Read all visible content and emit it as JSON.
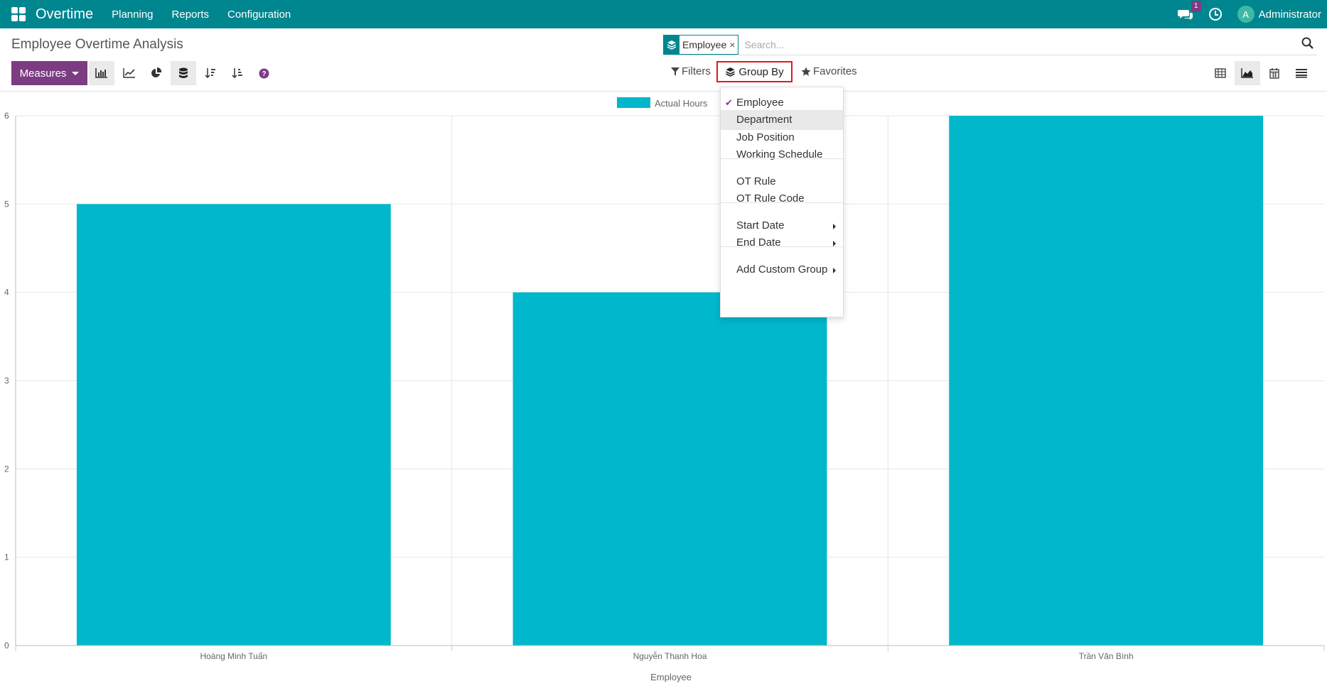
{
  "navbar": {
    "app_title": "Overtime",
    "menu": [
      "Planning",
      "Reports",
      "Configuration"
    ],
    "message_count": "1",
    "avatar_letter": "A",
    "user_name": "Administrator"
  },
  "control_panel": {
    "title": "Employee Overtime Analysis",
    "facet_label": "Employee",
    "facet_remove": "×",
    "search_placeholder": "Search...",
    "measures_label": "Measures",
    "filters_label": "Filters",
    "groupby_label": "Group By",
    "favorites_label": "Favorites",
    "graph_tools": [
      "bar-chart-icon",
      "line-chart-icon",
      "pie-chart-icon",
      "stacked-icon",
      "sort-descending-icon",
      "sort-ascending-icon",
      "help-icon"
    ],
    "views": [
      "pivot-icon",
      "graph-icon",
      "calendar-icon",
      "list-icon"
    ],
    "active_view": "graph-icon"
  },
  "groupby_menu": {
    "items": [
      {
        "label": "Employee",
        "checked": true
      },
      {
        "label": "Department",
        "hover": true
      },
      {
        "label": "Job Position"
      },
      {
        "label": "Working Schedule"
      },
      {
        "label": "OT Rule"
      },
      {
        "label": "OT Rule Code"
      },
      {
        "label": "Start Date",
        "submenu": true
      },
      {
        "label": "End Date",
        "submenu": true
      },
      {
        "label": "Add Custom Group",
        "submenu": true
      }
    ]
  },
  "chart_data": {
    "type": "bar",
    "categories": [
      "Hoàng Minh Tuấn",
      "Nguyễn Thanh Hoa",
      "Trần Văn Bình"
    ],
    "series": [
      {
        "name": "Actual Hours",
        "values": [
          5,
          4,
          6
        ]
      }
    ],
    "xlabel": "Employee",
    "ylabel": "",
    "ylim": [
      0,
      6
    ],
    "yticks": [
      0,
      1,
      2,
      3,
      4,
      5,
      6
    ],
    "grid": true,
    "legend_position": "top",
    "bar_color": "#00b7cb"
  }
}
